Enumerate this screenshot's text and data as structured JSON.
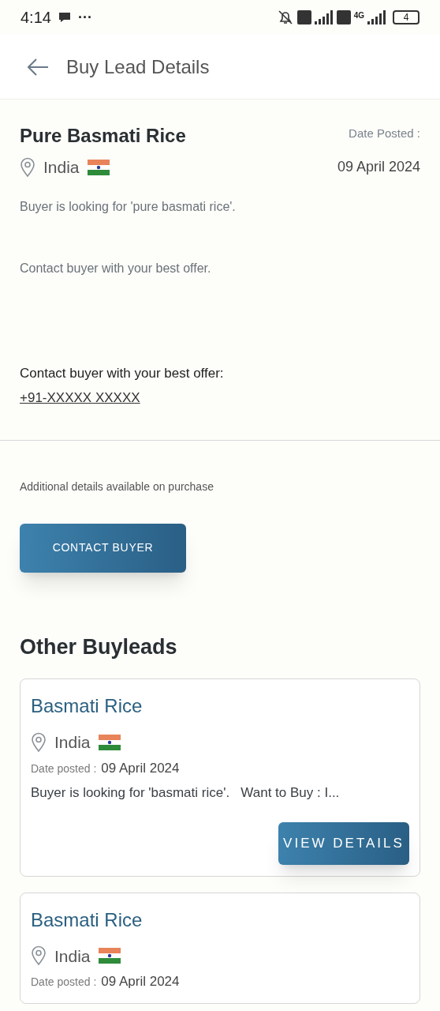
{
  "status_bar": {
    "time": "4:14",
    "more": "···",
    "network": "4G",
    "battery": "4"
  },
  "header": {
    "title": "Buy Lead Details"
  },
  "lead": {
    "title": "Pure Basmati Rice",
    "date_label": "Date Posted :",
    "country": "India",
    "date": "09 April 2024",
    "description": "Buyer is looking for 'pure basmati rice'.",
    "note": "Contact buyer with your best offer.",
    "contact_label": "Contact buyer with your best offer:",
    "phone": "+91-XXXXX XXXXX"
  },
  "additional": "Additional details available on purchase",
  "contact_button": "CONTACT BUYER",
  "other_title": "Other Buyleads",
  "other_leads": [
    {
      "title": "Basmati Rice",
      "country": "India",
      "date_label": "Date posted :",
      "date": "09 April 2024",
      "description": "Buyer is looking for 'basmati rice'.   Want to Buy : I...",
      "button": "VIEW DETAILS"
    },
    {
      "title": "Basmati Rice",
      "country": "India",
      "date_label": "Date posted :",
      "date": "09 April 2024"
    }
  ]
}
